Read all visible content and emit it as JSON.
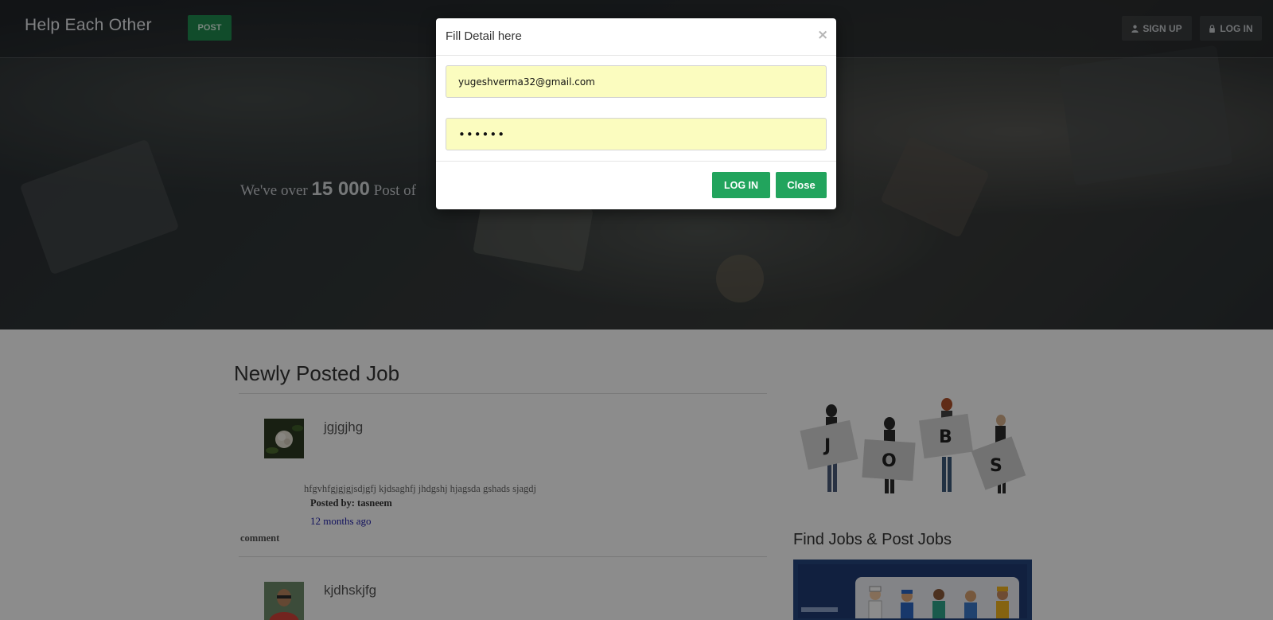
{
  "nav": {
    "brand": "Help Each Other",
    "post_label": "POST",
    "signup_label": "SIGN UP",
    "login_label": "LOG IN"
  },
  "hero": {
    "prefix": "We've over ",
    "count": "15 000",
    "suffix": " Post of"
  },
  "main": {
    "section_title": "Newly Posted Job",
    "jobs": [
      {
        "title": "jgjgjhg",
        "description": "hfgvhfgjgjgjsdjgfj kjdsaghfj jhdgshj hjagsda gshads sjagdj",
        "posted_by": "Posted by: tasneem",
        "time": "12 months ago",
        "comment_label": "comment"
      },
      {
        "title": "kjdhskjfg"
      }
    ]
  },
  "sidebar": {
    "jobs_letters": [
      "J",
      "O",
      "B",
      "S"
    ],
    "title": "Find Jobs & Post Jobs"
  },
  "modal": {
    "title": "Fill Detail here",
    "close_symbol": "×",
    "email_value": "yugeshverma32@gmail.com",
    "password_mask": "••••••",
    "login_label": "LOG IN",
    "close_label": "Close"
  },
  "colors": {
    "accent": "#22a45d",
    "post_button": "#1f8a4f",
    "link": "#2222aa",
    "field_bg": "#fbfcbf"
  },
  "icons": {
    "signup": "user-icon",
    "login": "lock-icon"
  }
}
